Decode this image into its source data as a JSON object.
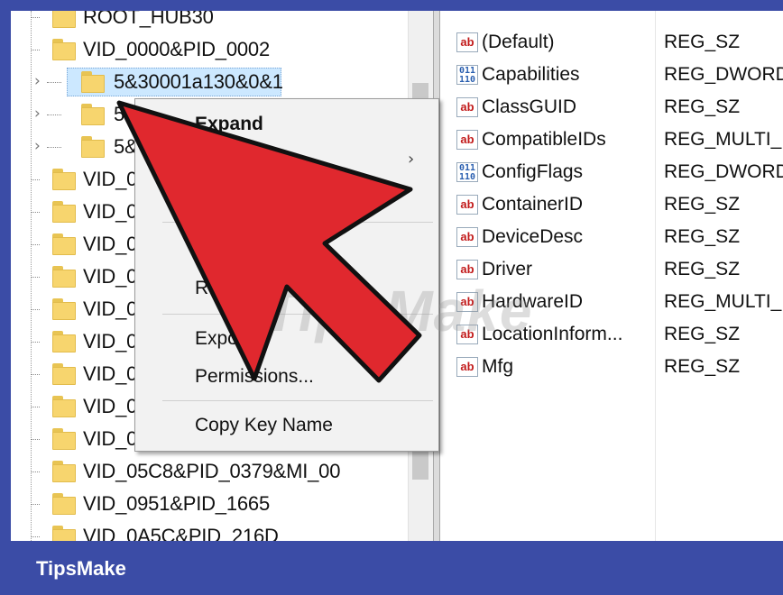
{
  "tree": {
    "items": [
      {
        "label": "ROOT_HUB30",
        "indent": 0,
        "caret": false
      },
      {
        "label": "VID_0000&PID_0002",
        "indent": 0,
        "caret": false
      },
      {
        "label": "5&30001a130&0&1",
        "indent": 1,
        "caret": true,
        "selected": true
      },
      {
        "label": "5&",
        "indent": 1,
        "caret": true
      },
      {
        "label": "5&",
        "indent": 1,
        "caret": true
      },
      {
        "label": "VID_0",
        "indent": 0,
        "caret": false
      },
      {
        "label": "VID_0",
        "indent": 0,
        "caret": false
      },
      {
        "label": "VID_0",
        "indent": 0,
        "caret": false
      },
      {
        "label": "VID_0",
        "indent": 0,
        "caret": false
      },
      {
        "label": "VID_0",
        "indent": 0,
        "caret": false
      },
      {
        "label": "VID_0",
        "indent": 0,
        "caret": false
      },
      {
        "label": "VID_0",
        "indent": 0,
        "caret": false
      },
      {
        "label": "VID_0",
        "indent": 0,
        "caret": false
      },
      {
        "label": "VID_05C8&PID_0379",
        "indent": 0,
        "caret": false
      },
      {
        "label": "VID_05C8&PID_0379&MI_00",
        "indent": 0,
        "caret": false
      },
      {
        "label": "VID_0951&PID_1665",
        "indent": 0,
        "caret": false
      },
      {
        "label": "VID_0A5C&PID_216D",
        "indent": 0,
        "caret": false
      }
    ]
  },
  "values": {
    "rows": [
      {
        "name": "(Default)",
        "type": "REG_SZ",
        "icon": "ab"
      },
      {
        "name": "Capabilities",
        "type": "REG_DWORD",
        "icon": "bin"
      },
      {
        "name": "ClassGUID",
        "type": "REG_SZ",
        "icon": "ab"
      },
      {
        "name": "CompatibleIDs",
        "type": "REG_MULTI_",
        "icon": "ab"
      },
      {
        "name": "ConfigFlags",
        "type": "REG_DWORD",
        "icon": "bin"
      },
      {
        "name": "ContainerID",
        "type": "REG_SZ",
        "icon": "ab"
      },
      {
        "name": "DeviceDesc",
        "type": "REG_SZ",
        "icon": "ab"
      },
      {
        "name": "Driver",
        "type": "REG_SZ",
        "icon": "ab"
      },
      {
        "name": "HardwareID",
        "type": "REG_MULTI_",
        "icon": "ab"
      },
      {
        "name": "LocationInform...",
        "type": "REG_SZ",
        "icon": "ab"
      },
      {
        "name": "Mfg",
        "type": "REG_SZ",
        "icon": "ab"
      }
    ]
  },
  "context_menu": {
    "expand": "Expand",
    "rename_partial": "R",
    "export_partial": "Expo",
    "permissions": "Permissions...",
    "copy_key_name": "Copy Key Name"
  },
  "watermark": "TipsMake",
  "footer": {
    "brand": "TipsMake"
  },
  "colors": {
    "frame": "#3b4ca6",
    "arrow": "#e0282e",
    "selection": "#cce8ff"
  }
}
